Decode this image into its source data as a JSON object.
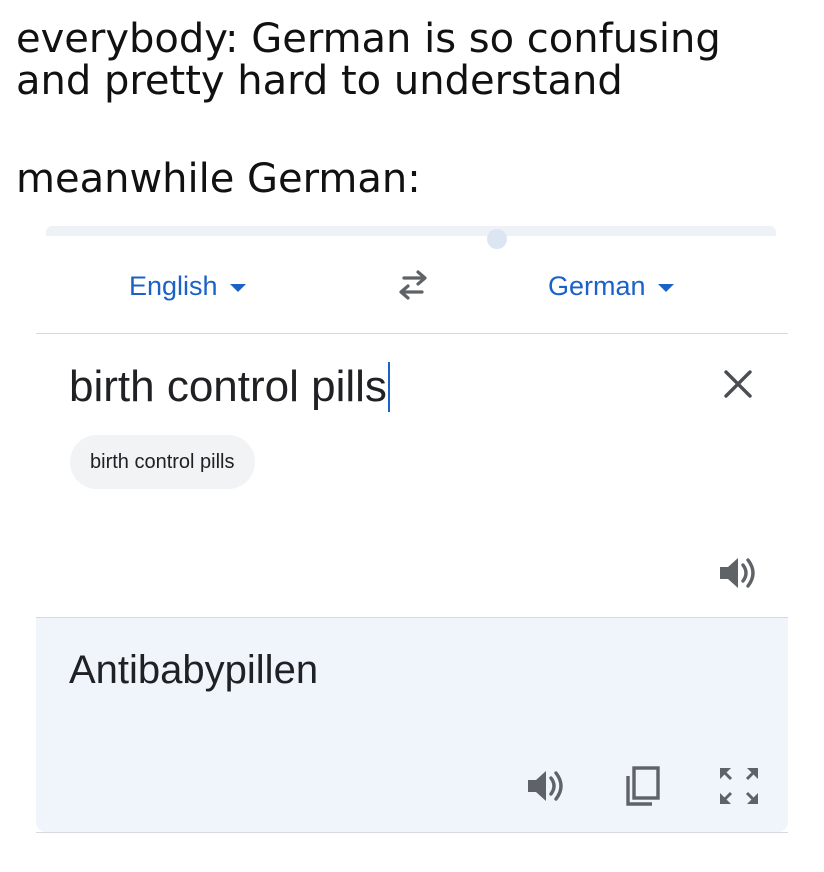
{
  "caption": {
    "line1": "everybody: German is so confusing",
    "line2": "and pretty hard to understand",
    "line3": "meanwhile German:"
  },
  "translator": {
    "source_language": "English",
    "target_language": "German",
    "input_value": "birth control pills",
    "suggestion_chip": "birth control pills",
    "output_text": "Antibabypillen"
  },
  "icons": {
    "swap": "swap-languages-icon",
    "clear": "close-icon",
    "source_speaker": "speaker-icon",
    "output_speaker": "speaker-icon",
    "copy": "copy-icon",
    "fullscreen": "fullscreen-icon",
    "dropdown": "caret-down-icon"
  },
  "colors": {
    "accent": "#1a62c6",
    "icon_gray": "#5f6368",
    "output_background": "#f0f5fb",
    "chip_background": "#f1f3f4",
    "divider": "#d6d9dd"
  }
}
